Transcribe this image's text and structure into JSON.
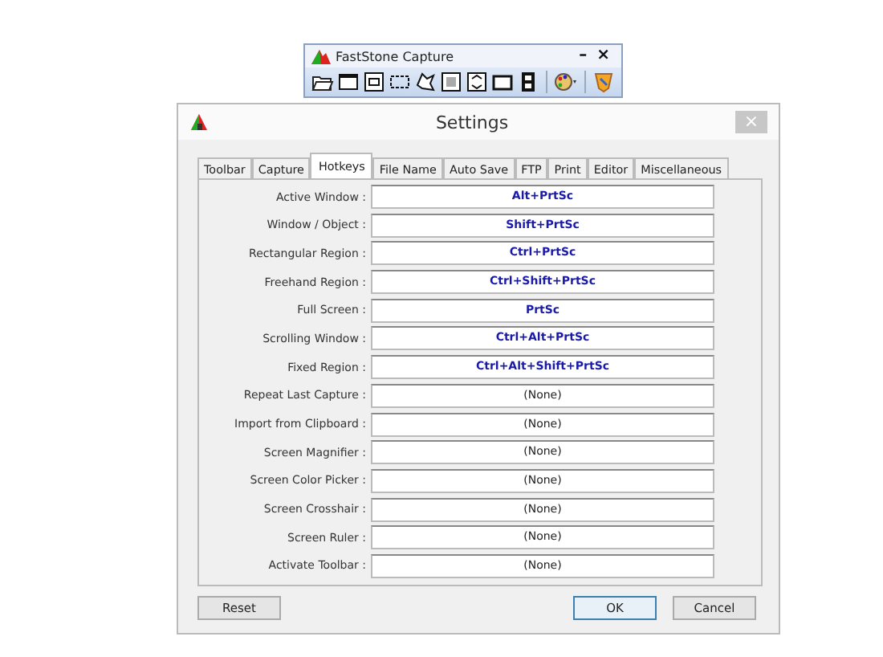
{
  "toolbar_window": {
    "title": "FastStone Capture",
    "minimize": "–",
    "close": "×"
  },
  "dialog": {
    "title": "Settings",
    "close": "×"
  },
  "tabs": [
    {
      "label": "Toolbar",
      "selected": false
    },
    {
      "label": "Capture",
      "selected": false
    },
    {
      "label": "Hotkeys",
      "selected": true
    },
    {
      "label": "File Name",
      "selected": false
    },
    {
      "label": "Auto Save",
      "selected": false
    },
    {
      "label": "FTP",
      "selected": false
    },
    {
      "label": "Print",
      "selected": false
    },
    {
      "label": "Editor",
      "selected": false
    },
    {
      "label": "Miscellaneous",
      "selected": false
    }
  ],
  "hotkeys": [
    {
      "label": "Active Window :",
      "value": "Alt+PrtSc",
      "assigned": true
    },
    {
      "label": "Window / Object :",
      "value": "Shift+PrtSc",
      "assigned": true
    },
    {
      "label": "Rectangular Region :",
      "value": "Ctrl+PrtSc",
      "assigned": true
    },
    {
      "label": "Freehand Region :",
      "value": "Ctrl+Shift+PrtSc",
      "assigned": true
    },
    {
      "label": "Full Screen :",
      "value": "PrtSc",
      "assigned": true
    },
    {
      "label": "Scrolling Window :",
      "value": "Ctrl+Alt+PrtSc",
      "assigned": true
    },
    {
      "label": "Fixed Region :",
      "value": "Ctrl+Alt+Shift+PrtSc",
      "assigned": true
    },
    {
      "label": "Repeat Last Capture :",
      "value": "(None)",
      "assigned": false
    },
    {
      "label": "Import from Clipboard :",
      "value": "(None)",
      "assigned": false
    },
    {
      "label": "Screen Magnifier :",
      "value": "(None)",
      "assigned": false
    },
    {
      "label": "Screen Color Picker :",
      "value": "(None)",
      "assigned": false
    },
    {
      "label": "Screen Crosshair :",
      "value": "(None)",
      "assigned": false
    },
    {
      "label": "Screen Ruler :",
      "value": "(None)",
      "assigned": false
    },
    {
      "label": "Activate Toolbar :",
      "value": "(None)",
      "assigned": false
    }
  ],
  "buttons": [
    {
      "label": "Reset",
      "kind": "left",
      "selected": false
    },
    {
      "label": "OK",
      "kind": "right",
      "selected": true
    },
    {
      "label": "Cancel",
      "kind": "right",
      "selected": false
    }
  ]
}
